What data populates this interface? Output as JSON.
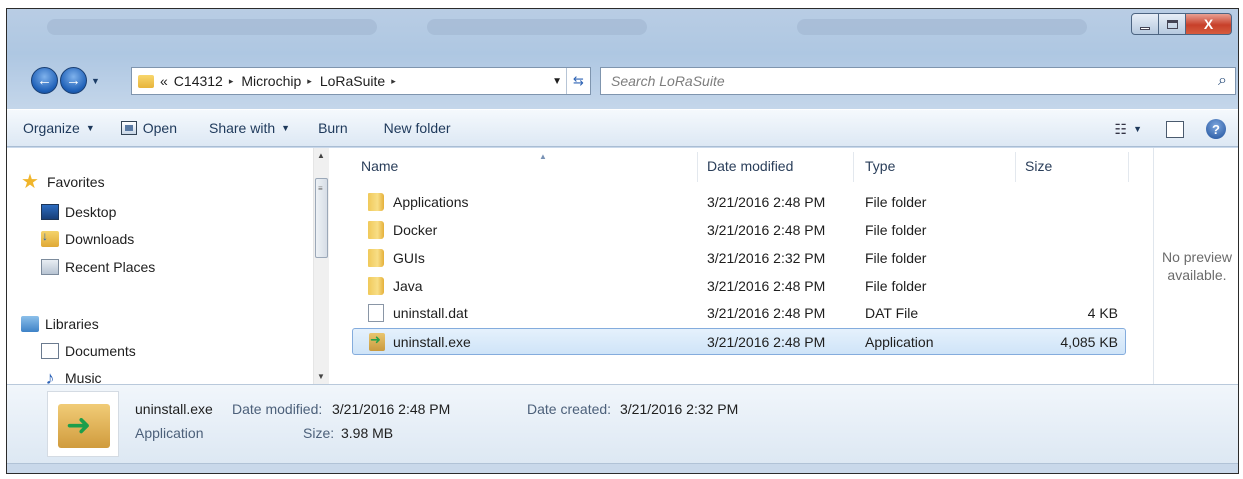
{
  "window": {
    "minimize_glyph": "",
    "close_glyph": "X"
  },
  "address": {
    "overflow": "«",
    "crumbs": [
      "C14312",
      "Microchip",
      "LoRaSuite"
    ],
    "separator": "▸"
  },
  "search": {
    "placeholder": "Search LoRaSuite"
  },
  "toolbar": {
    "organize": "Organize",
    "open": "Open",
    "share_with": "Share with",
    "burn": "Burn",
    "new_folder": "New folder"
  },
  "nav": {
    "favorites": "Favorites",
    "desktop": "Desktop",
    "downloads": "Downloads",
    "recent_places": "Recent Places",
    "libraries": "Libraries",
    "documents": "Documents",
    "music": "Music"
  },
  "columns": {
    "name": "Name",
    "date_modified": "Date modified",
    "type": "Type",
    "size": "Size"
  },
  "files": [
    {
      "name": "Applications",
      "date": "3/21/2016 2:48 PM",
      "type": "File folder",
      "size": "",
      "icon": "folder-icon"
    },
    {
      "name": "Docker",
      "date": "3/21/2016 2:48 PM",
      "type": "File folder",
      "size": "",
      "icon": "folder-icon"
    },
    {
      "name": "GUIs",
      "date": "3/21/2016 2:32 PM",
      "type": "File folder",
      "size": "",
      "icon": "folder-icon"
    },
    {
      "name": "Java",
      "date": "3/21/2016 2:48 PM",
      "type": "File folder",
      "size": "",
      "icon": "folder-icon"
    },
    {
      "name": "uninstall.dat",
      "date": "3/21/2016 2:48 PM",
      "type": "DAT File",
      "size": "4 KB",
      "icon": "file-icon"
    },
    {
      "name": "uninstall.exe",
      "date": "3/21/2016 2:48 PM",
      "type": "Application",
      "size": "4,085 KB",
      "icon": "exe-icon"
    }
  ],
  "preview": {
    "line1": "No preview",
    "line2": "available."
  },
  "details": {
    "name": "uninstall.exe",
    "type": "Application",
    "date_modified_label": "Date modified:",
    "date_modified": "3/21/2016 2:48 PM",
    "size_label": "Size:",
    "size": "3.98 MB",
    "date_created_label": "Date created:",
    "date_created": "3/21/2016 2:32 PM"
  },
  "colors": {
    "selection_border": "#84acdd",
    "selection_fill": "#cfe4f8",
    "close_button": "#c7402a"
  }
}
